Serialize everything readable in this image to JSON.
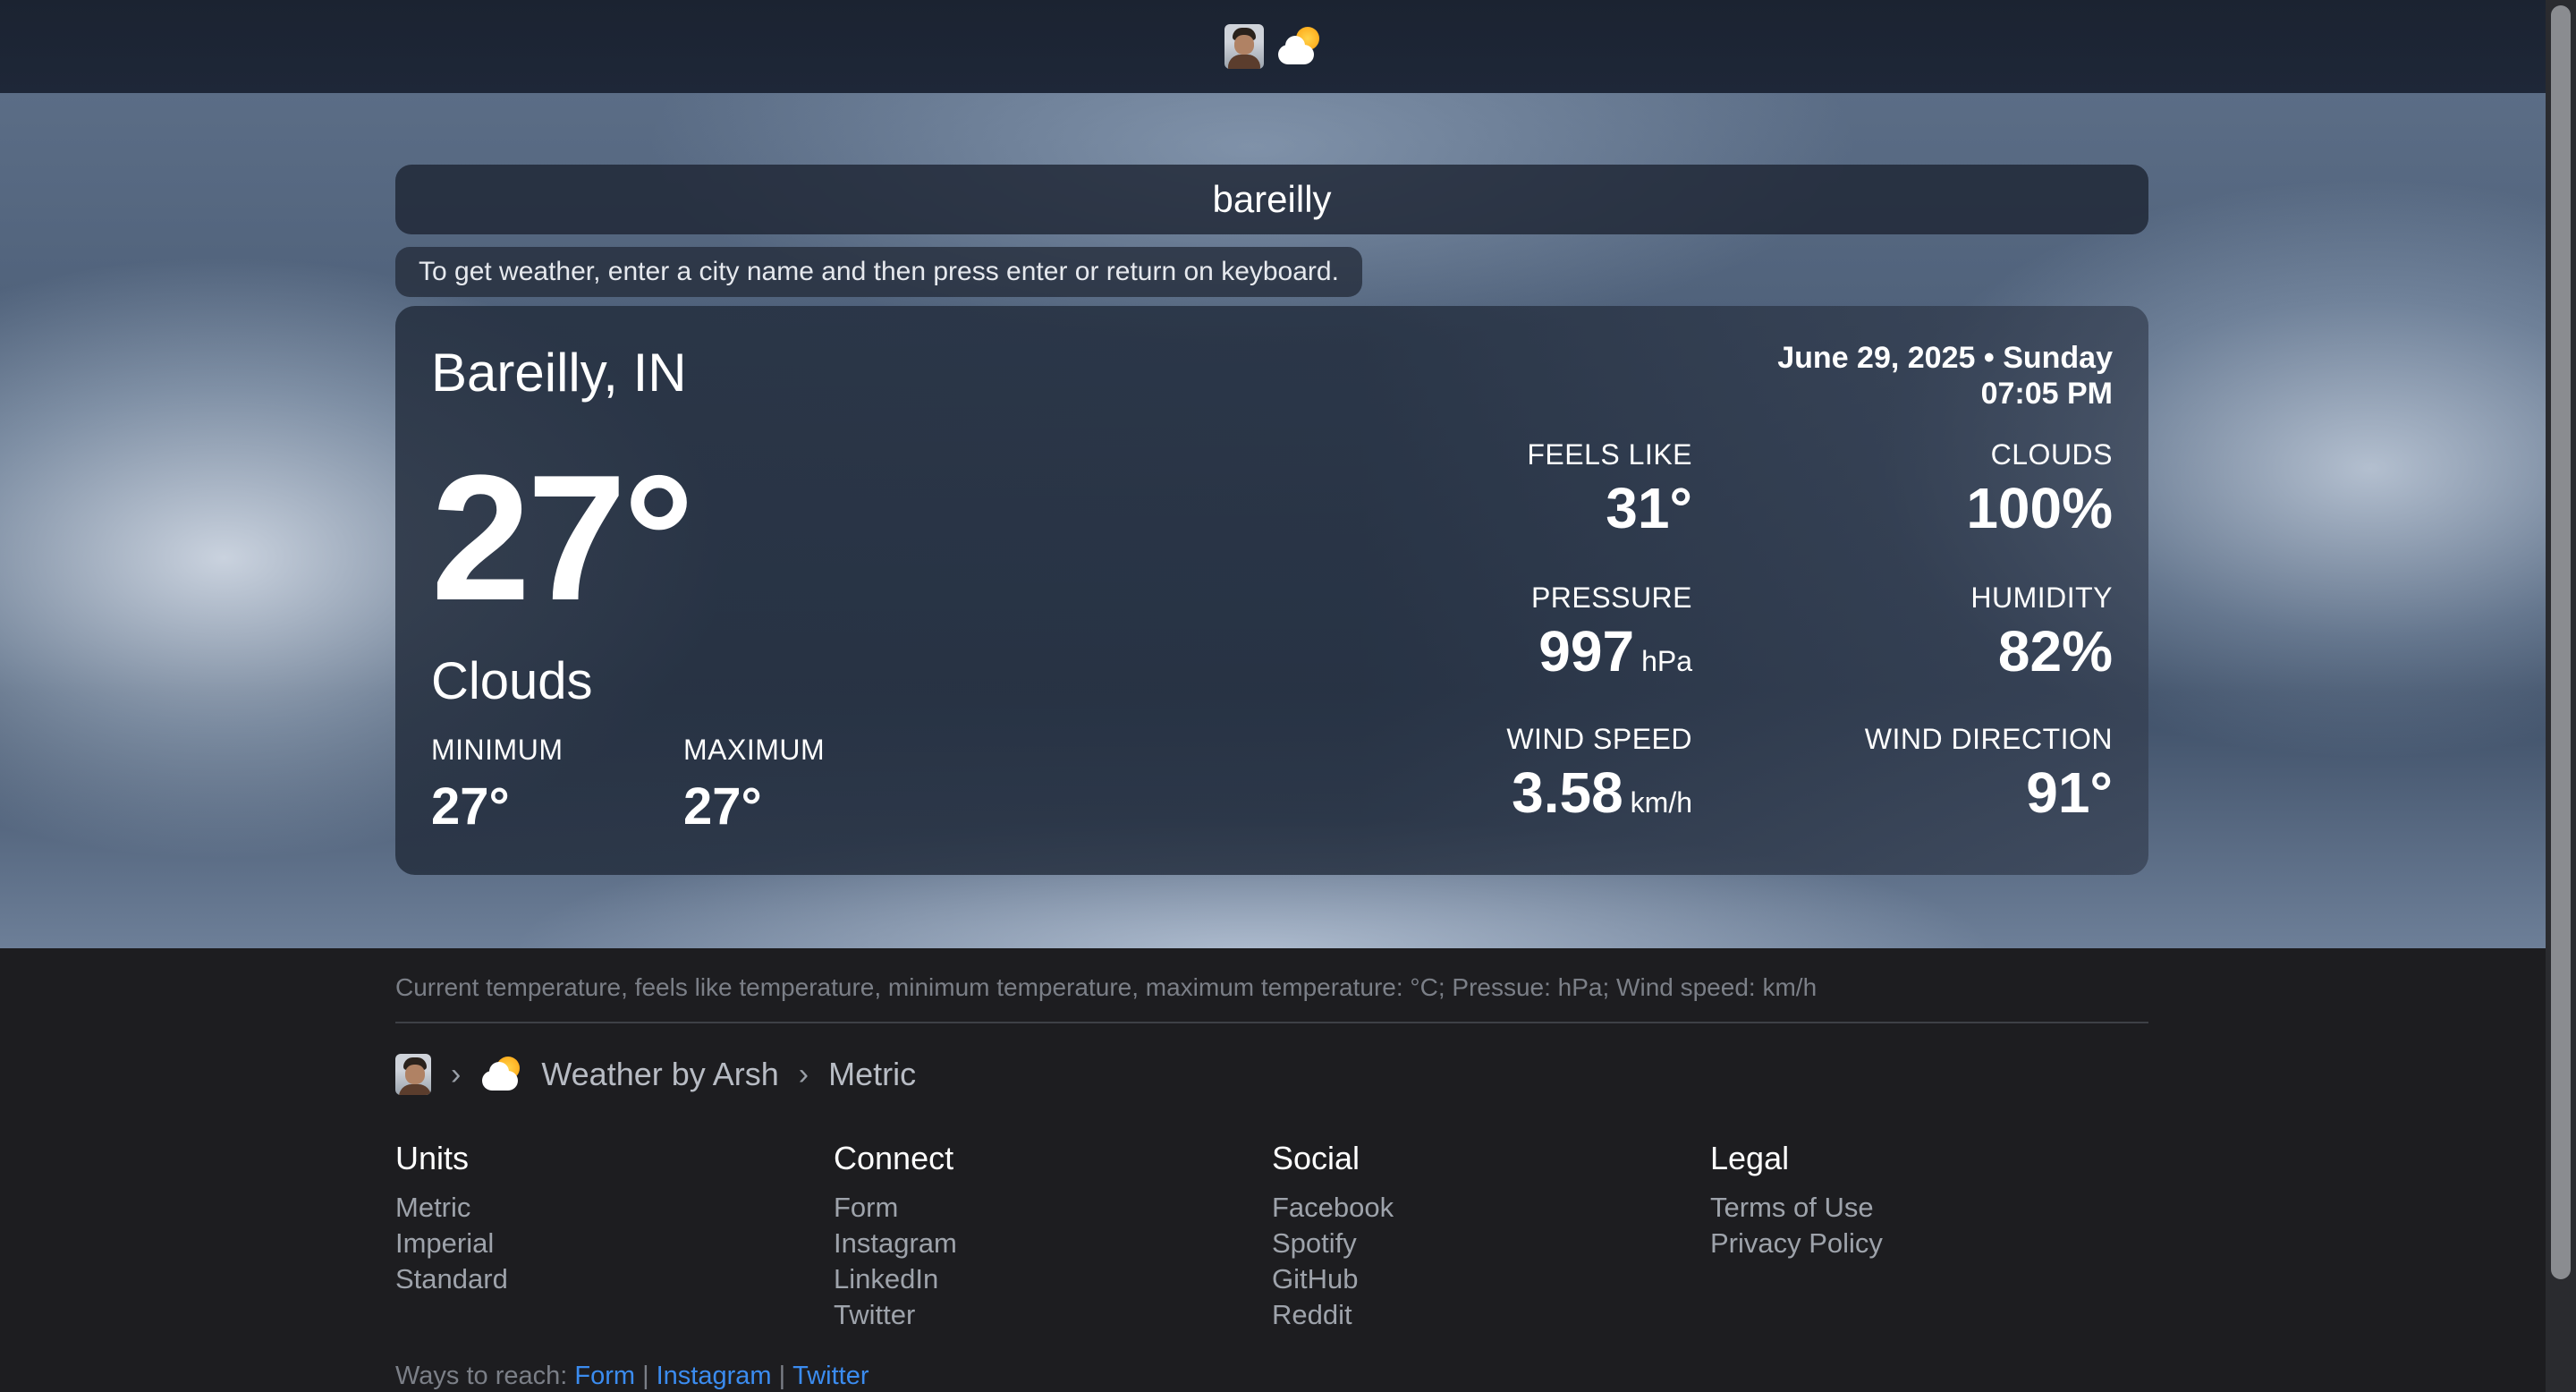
{
  "search": {
    "value": "bareilly"
  },
  "hint": "To get weather, enter a city name and then press enter or return on keyboard.",
  "weather": {
    "city": "Bareilly, IN",
    "temperature": "27°",
    "condition": "Clouds",
    "min_label": "MINIMUM",
    "min_value": "27°",
    "max_label": "MAXIMUM",
    "max_value": "27°",
    "date": "June 29, 2025 • Sunday",
    "time": "07:05 PM",
    "feels_like": {
      "label": "FEELS LIKE",
      "value": "31°"
    },
    "clouds": {
      "label": "CLOUDS",
      "value": "100%"
    },
    "pressure": {
      "label": "PRESSURE",
      "value": "997",
      "unit": "hPa"
    },
    "humidity": {
      "label": "HUMIDITY",
      "value": "82%"
    },
    "wind_speed": {
      "label": "WIND SPEED",
      "value": "3.58",
      "unit": "km/h"
    },
    "wind_direction": {
      "label": "WIND DIRECTION",
      "value": "91°"
    }
  },
  "footer": {
    "note": "Current temperature, feels like temperature, minimum temperature, maximum temperature: °C; Pressue: hPa; Wind speed: km/h",
    "breadcrumb": {
      "app": "Weather by Arsh",
      "current": "Metric"
    },
    "columns": {
      "units": {
        "title": "Units",
        "items": [
          "Metric",
          "Imperial",
          "Standard"
        ]
      },
      "connect": {
        "title": "Connect",
        "items": [
          "Form",
          "Instagram",
          "LinkedIn",
          "Twitter"
        ]
      },
      "social": {
        "title": "Social",
        "items": [
          "Facebook",
          "Spotify",
          "GitHub",
          "Reddit"
        ]
      },
      "legal": {
        "title": "Legal",
        "items": [
          "Terms of Use",
          "Privacy Policy"
        ]
      }
    },
    "ways": {
      "label": "Ways to reach:",
      "links": [
        "Form",
        "Instagram",
        "Twitter"
      ],
      "separator": "|"
    }
  },
  "colors": {
    "link": "#3b8cf0",
    "card": "#242e3e",
    "footer_bg": "#1d1d20"
  }
}
